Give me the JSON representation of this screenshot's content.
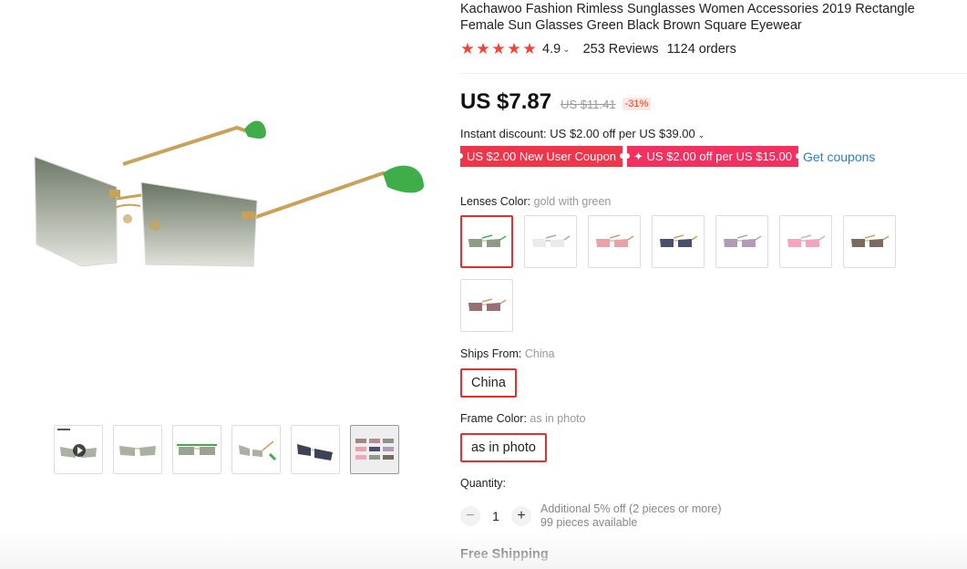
{
  "product": {
    "title": "Kachawoo Fashion Rimless Sunglasses Women Accessories 2019 Rectangle Female Sun Glasses Green Black Brown Square Eyewear",
    "rating": "4.9",
    "reviews": "253 Reviews",
    "orders": "1124 orders",
    "star_count": 5
  },
  "price": {
    "current": "US $7.87",
    "original": "US $11.41",
    "discount": "-31%"
  },
  "promo": {
    "instant_discount": "Instant discount: US $2.00 off per US $39.00",
    "coupon_1": "US $2.00 New User Coupon",
    "coupon_2": "✦ US $2.00 off per US $15.00",
    "get_coupons": "Get coupons"
  },
  "lens_color": {
    "label": "Lenses Color:",
    "value": "gold with green",
    "options": [
      {
        "name": "gold-green",
        "lens": "#8f9a88",
        "frame": "#4caf50"
      },
      {
        "name": "silver-clear",
        "lens": "#e8ecec",
        "frame": "#aaaaaa"
      },
      {
        "name": "gold-pink",
        "lens": "#e8a3a8",
        "frame": "#c9a26b"
      },
      {
        "name": "gold-navy",
        "lens": "#4a4f6e",
        "frame": "#c9a26b"
      },
      {
        "name": "silver-purple",
        "lens": "#b39ab8",
        "frame": "#aaaaaa"
      },
      {
        "name": "silver-pink",
        "lens": "#f2a6bd",
        "frame": "#bbbbbb"
      },
      {
        "name": "gold-brown",
        "lens": "#7c6a5f",
        "frame": "#c9a26b"
      },
      {
        "name": "gold-wine",
        "lens": "#9b6d74",
        "frame": "#c9a26b"
      }
    ]
  },
  "ships_from": {
    "label": "Ships From:",
    "value": "China",
    "option": "China"
  },
  "frame_color": {
    "label": "Frame Color:",
    "value": "as in photo",
    "option": "as in photo"
  },
  "quantity": {
    "label": "Quantity:",
    "value": "1",
    "minus": "−",
    "plus": "+",
    "note_1": "Additional 5% off (2 pieces or more)",
    "note_2": "99 pieces available"
  },
  "shipping": {
    "label": "Free Shipping"
  },
  "gallery": {
    "thumbnails": [
      "video",
      "front",
      "front-flat",
      "side",
      "dark",
      "assortment"
    ]
  },
  "colors": {
    "accent_red": "#e62e2e",
    "star": "#f44236",
    "link_blue": "#2a7fc1",
    "coupon_red": "#f0344a"
  }
}
